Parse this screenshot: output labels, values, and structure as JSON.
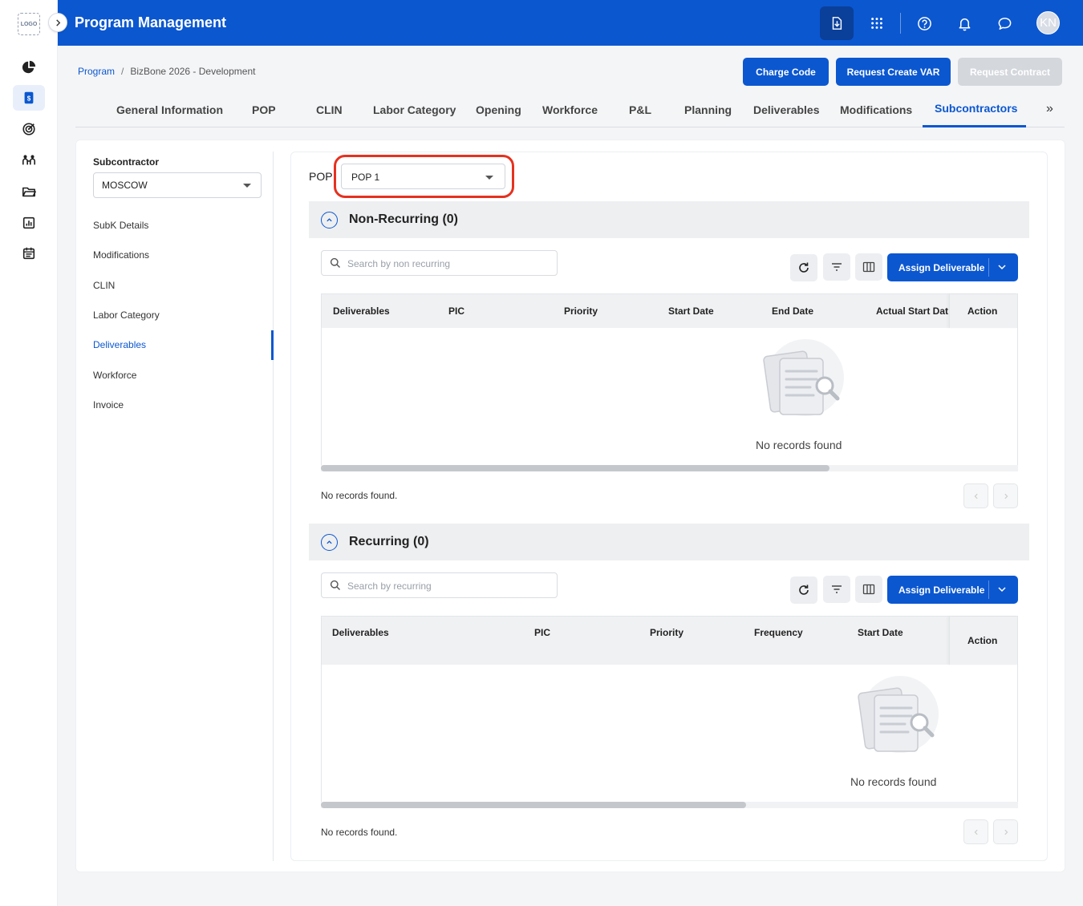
{
  "app": {
    "logo": "LOGO",
    "title": "Program Management",
    "avatar_initials": "KN"
  },
  "breadcrumb": {
    "root": "Program",
    "current": "BizBone 2026 - Development"
  },
  "header_buttons": {
    "charge_code": "Charge Code",
    "request_var": "Request Create VAR",
    "request_contract": "Request Contract"
  },
  "tabs": [
    "General Information",
    "POP",
    "CLIN",
    "Labor Category",
    "Opening",
    "Workforce",
    "P&L",
    "Planning",
    "Deliverables",
    "Modifications",
    "Subcontractors"
  ],
  "tabs_more": "»",
  "subcontractor": {
    "label": "Subcontractor",
    "value": "MOSCOW"
  },
  "side_nav": [
    "SubK Details",
    "Modifications",
    "CLIN",
    "Labor Category",
    "Deliverables",
    "Workforce",
    "Invoice"
  ],
  "pop": {
    "label": "POP",
    "value": "POP 1"
  },
  "non_recurring": {
    "title": "Non-Recurring (0)",
    "search_placeholder": "Search by non recurring",
    "assign_label": "Assign Deliverable",
    "columns": [
      "Deliverables",
      "PIC",
      "Priority",
      "Start Date",
      "End Date",
      "Actual Start Dat",
      "Action"
    ],
    "empty_text": "No records found",
    "footer_text": "No records found.",
    "scroll_fraction": 0.73
  },
  "recurring": {
    "title": "Recurring (0)",
    "search_placeholder": "Search by recurring",
    "assign_label": "Assign Deliverable",
    "columns": [
      "Deliverables",
      "PIC",
      "Priority",
      "Frequency",
      "Start Date",
      "Action"
    ],
    "empty_text": "No records found",
    "footer_text": "No records found.",
    "scroll_fraction": 0.61
  },
  "colors": {
    "primary": "#0b57d0",
    "highlight": "#e5311f"
  }
}
